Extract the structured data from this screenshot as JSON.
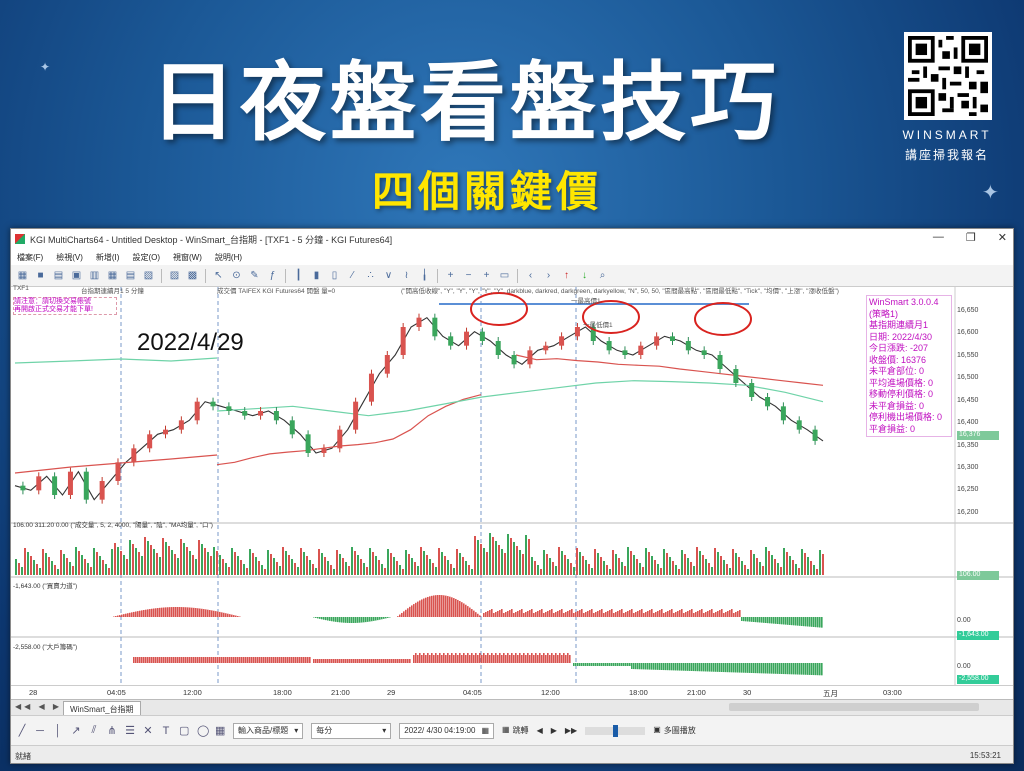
{
  "banner": {
    "title": "日夜盤看盤技巧",
    "subtitle": "四個關鍵價",
    "qr_brand": "WINSMART",
    "qr_caption": "講座掃我報名"
  },
  "window": {
    "title": "KGI MultiCharts64 - Untitled Desktop - WinSmart_台指期 - [TXF1 - 5 分鐘 - KGI Futures64]",
    "controls": [
      "—",
      "❐",
      "✕"
    ]
  },
  "menu": [
    "檔案(F)",
    "檢視(V)",
    "新增(I)",
    "設定(O)",
    "視窗(W)",
    "說明(H)"
  ],
  "chart": {
    "date_annotation": "2022/4/29",
    "symbol_bar": "TXF1",
    "symbol_info": "台指期連續月1 5 分鐘",
    "symbol_info2": "成交價  TAIFEX  KGI Futures64  開盤 量=0",
    "indicator_info": "(\"開高低收線\", \"Y\", \"Y\", \"Y\", \"Y\", \"Y\", darkblue, darkred, darkgreen, darkyellow, \"N\", 50, 50, \"區間最高點\", \"區間最低點\", \"Tick\", \"均價\", \"上漲\", \"漲收低盤\")",
    "top_line_label": "一最高價1",
    "mid_line_label": "一最低價1",
    "warning_lines": [
      "請注意：請切換交易帳號",
      "再開啟正式交易才能下單!"
    ],
    "info_box": [
      "WinSmart 3.0.0.4",
      "(策略1)",
      "基指期連續月1",
      "日期: 2022/4/30",
      "今日漲跌: -207",
      "收盤價: 16376",
      "未平倉部位: 0",
      "平均進場價格: 0",
      "移動停利價格: 0",
      "未平倉損益: 0",
      "停利機出場價格: 0",
      "平倉損益: 0"
    ],
    "price_axis": [
      "16,650",
      "16,600",
      "16,550",
      "16,500",
      "16,450",
      "16,400",
      "16,350",
      "16,300",
      "16,250",
      "16,200"
    ],
    "last_price": "16,376",
    "volume_pane_label": "106.00  311.20  0.00  (\"成交量\", 5, 2, 4000, \"陽量\", \"陰\", \"MA均量\", \"口\")",
    "volume_tag": "106.00",
    "pane3_label": "-1,643.00  (\"買賣力道\")",
    "pane3_axis": "0.00",
    "pane3_tag": "-1,643.00",
    "pane4_label": "-2,558.00  (\"大戶籌碼\")",
    "pane4_axis": "0.00",
    "pane4_tag": "-2,558.00",
    "x_axis": [
      "28",
      "04:05",
      "12:00",
      "18:00",
      "21:00",
      "29",
      "04:05",
      "12:00",
      "18:00",
      "21:00",
      "30",
      "五月",
      "03:00"
    ]
  },
  "tabs": {
    "active": "WinSmart_台指期",
    "nav": "◀◀ ◀ ▶ ▶▶"
  },
  "drawbar": {
    "product_select": "輸入商品/標題",
    "interval_select": "每分",
    "datetime": "2022/ 4/30 04:19:00",
    "jump": "跳轉",
    "multi_play": "多圖播放"
  },
  "status": {
    "left": "就緒",
    "time": "15:53:21"
  },
  "chart_data": {
    "type": "line",
    "title": "",
    "price_range": [
      16200,
      16650
    ],
    "price_ticks": [
      16650,
      16600,
      16550,
      16500,
      16450,
      16400,
      16350,
      16300,
      16250,
      16200
    ],
    "x_ticks": [
      "28",
      "04:05",
      "12:00",
      "18:00",
      "21:00",
      "29",
      "04:05",
      "12:00",
      "18:00",
      "21:00",
      "30",
      "五月",
      "03:00"
    ],
    "series": [
      {
        "name": "price",
        "values": [
          16280,
          16270,
          16300,
          16260,
          16310,
          16250,
          16290,
          16330,
          16360,
          16390,
          16400,
          16420,
          16460,
          16450,
          16440,
          16430,
          16440,
          16420,
          16390,
          16350,
          16360,
          16400,
          16460,
          16520,
          16560,
          16620,
          16640,
          16600,
          16580,
          16610,
          16590,
          16560,
          16540,
          16570,
          16580,
          16600,
          16620,
          16590,
          16570,
          16560,
          16580,
          16600,
          16590,
          16570,
          16560,
          16530,
          16500,
          16470,
          16450,
          16420,
          16400,
          16376
        ]
      },
      {
        "values": [
          16560,
          16550,
          16552,
          16548,
          16545,
          16540,
          16538,
          16536,
          16530,
          16525,
          16520,
          16515,
          16510,
          16505,
          16500,
          16495
        ]
      },
      {
        "values": [
          16325,
          16330,
          16340,
          16348,
          16352,
          16355,
          16360,
          16365,
          16368,
          16372,
          16380,
          16400,
          16430,
          16450,
          16465,
          16475
        ]
      },
      {
        "values": [
          16440,
          16445,
          16450,
          16440,
          16430,
          16440,
          16455,
          16470,
          16480,
          16490,
          16500,
          16505,
          16503,
          16500,
          16495,
          16480,
          16460
        ]
      }
    ],
    "annotation": "2022/4/29",
    "last": 16376
  }
}
